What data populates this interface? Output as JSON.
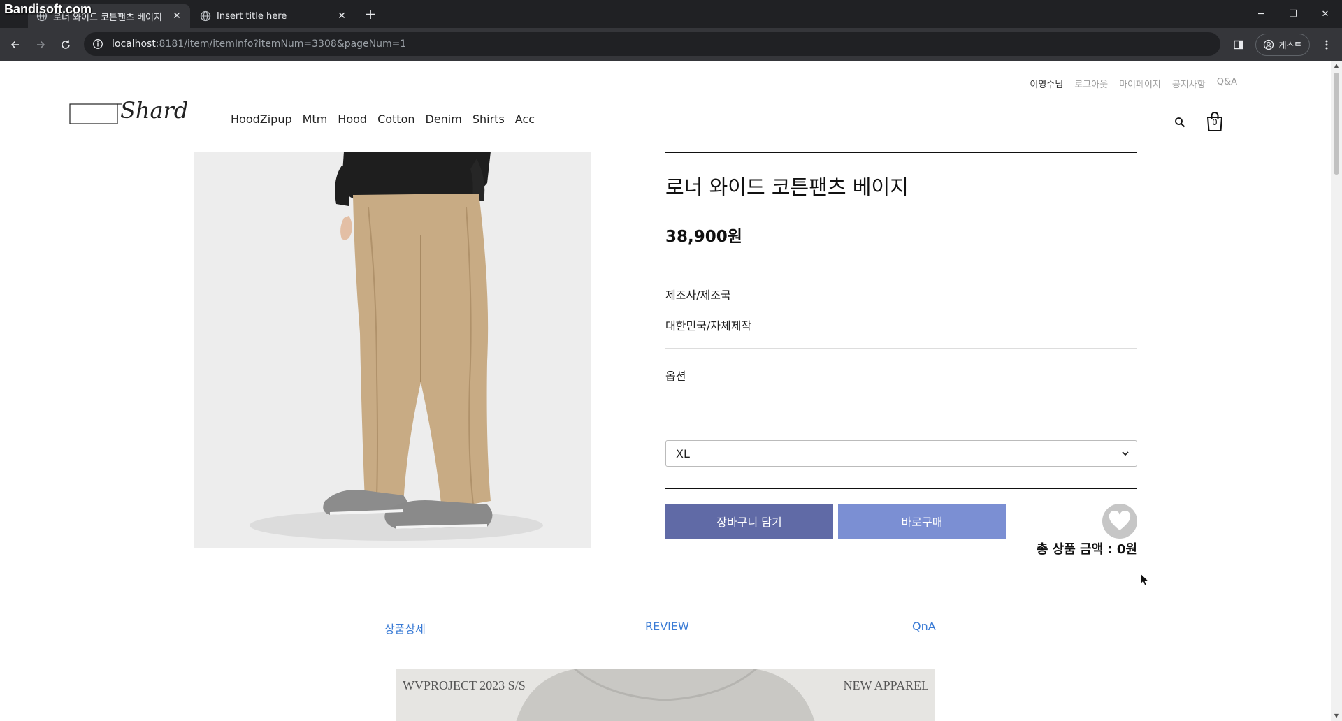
{
  "browser": {
    "watermark": "Bandisoft.com",
    "tabs": [
      {
        "title": "로너 와이드 코튼팬츠 베이지",
        "close": "✕"
      },
      {
        "title": "Insert title here",
        "close": "✕"
      }
    ],
    "new_tab": "+",
    "window_controls": {
      "minimize": "─",
      "restore": "❐",
      "close": "✕"
    },
    "url_host": "localhost",
    "url_path": ":8181/item/itemInfo?itemNum=3308&pageNum=1",
    "profile_label": "게스트"
  },
  "header": {
    "user_link": "이영수님",
    "logout": "로그아웃",
    "mypage": "마이페이지",
    "notice": "공지사항",
    "qna": "Q&A",
    "logo_text": "Shard",
    "nav": [
      "HoodZipup",
      "Mtm",
      "Hood",
      "Cotton",
      "Denim",
      "Shirts",
      "Acc"
    ],
    "cart_count": "0"
  },
  "product": {
    "name": "로너 와이드 코튼팬츠 베이지",
    "price": "38,900원",
    "manufacturer_label": "제조사/제조국",
    "manufacturer_value": "대한민국/자체제작",
    "option_label": "옵션",
    "option_selected": "XL",
    "add_to_cart": "장바구니 담기",
    "buy_now": "바로구매",
    "total": "총 상품 금액 : 0원"
  },
  "detail_tabs": [
    "상품상세",
    "REVIEW",
    "QnA"
  ],
  "banner": {
    "left": "WVPROJECT 2023 S/S",
    "right": "NEW APPAREL"
  },
  "colors": {
    "cart_button": "#606aa6",
    "buy_button": "#7b8fd3",
    "tab_link": "#3a7bd5"
  }
}
